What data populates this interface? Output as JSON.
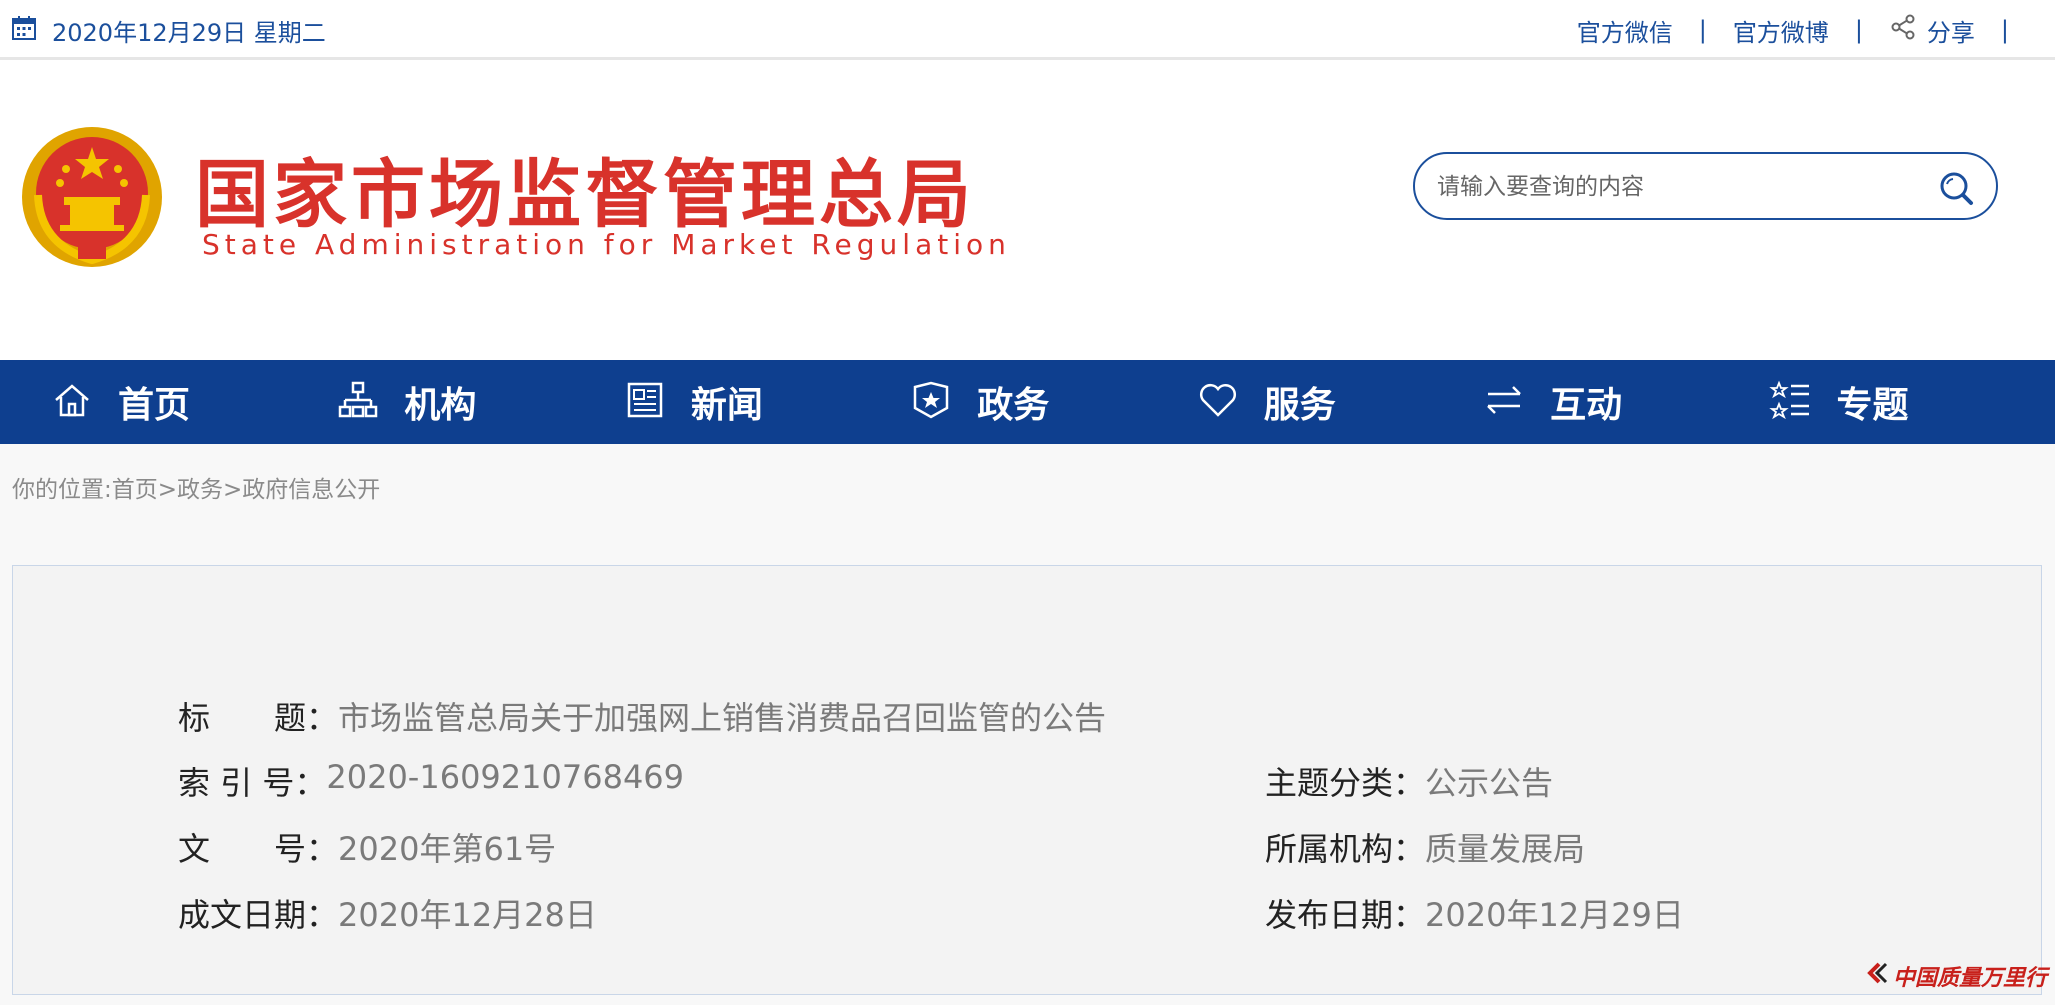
{
  "topbar": {
    "date": "2020年12月29日 星期二",
    "links": [
      "官方微信",
      "官方微博",
      "分享"
    ],
    "separator": "|"
  },
  "header": {
    "title_cn": "国家市场监督管理总局",
    "title_en": "State Administration for Market Regulation",
    "search_placeholder": "请输入要查询的内容"
  },
  "nav": {
    "items": [
      {
        "label": "首页",
        "icon": "home-icon"
      },
      {
        "label": "机构",
        "icon": "org-chart-icon"
      },
      {
        "label": "新闻",
        "icon": "news-icon"
      },
      {
        "label": "政务",
        "icon": "government-icon"
      },
      {
        "label": "服务",
        "icon": "heart-icon"
      },
      {
        "label": "互动",
        "icon": "exchange-icon"
      },
      {
        "label": "专题",
        "icon": "topic-list-icon"
      }
    ]
  },
  "breadcrumb": "你的位置:首页>政务>政府信息公开",
  "info": {
    "title_label": "标　　题：",
    "title_value": "市场监管总局关于加强网上销售消费品召回监管的公告",
    "index_label": "索 引 号：",
    "index_value": "2020-1609210768469",
    "topic_label": "主题分类：",
    "topic_value": "公示公告",
    "docno_label": "文　　号：",
    "docno_value": "2020年第61号",
    "org_label": "所属机构：",
    "org_value": "质量发展局",
    "written_label": "成文日期：",
    "written_value": "2020年12月28日",
    "publish_label": "发布日期：",
    "publish_value": "2020年12月29日"
  },
  "watermark": "中国质量万里行",
  "colors": {
    "brand_blue": "#0e3f8f",
    "brand_red": "#d8322b",
    "link_blue": "#1b4f9c"
  }
}
